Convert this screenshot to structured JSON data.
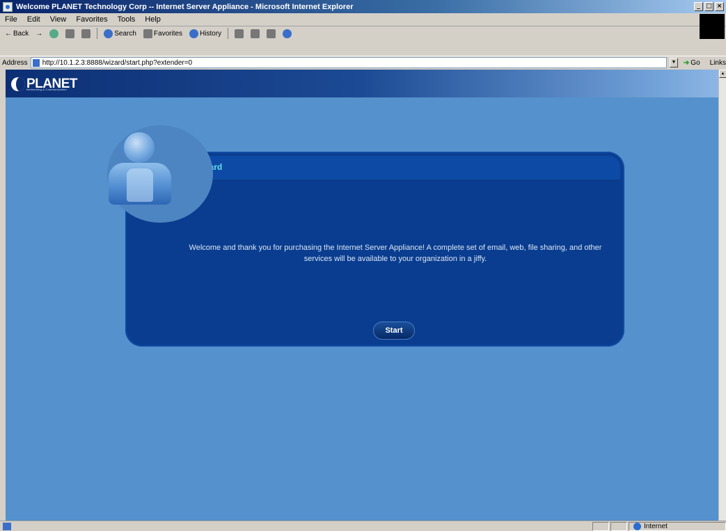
{
  "window": {
    "title": "Welcome PLANET Technology Corp -- Internet Server Appliance - Microsoft Internet Explorer",
    "controls": [
      "_",
      "□",
      "×"
    ]
  },
  "menubar": {
    "items": [
      "File",
      "Edit",
      "View",
      "Favorites",
      "Tools",
      "Help"
    ]
  },
  "toolbar": {
    "back_label": "Back",
    "search_label": "Search",
    "favorites_label": "Favorites",
    "history_label": "History"
  },
  "address": {
    "label": "Address",
    "url": "http://10.1.2.3:8888/wizard/start.php?extender=0",
    "go_label": "Go",
    "links_label": "Links"
  },
  "brand": {
    "name": "PLANET",
    "tagline": "Networking & Communication"
  },
  "wizard": {
    "title": "Wizard",
    "welcome_text": "Welcome and thank you for purchasing the Internet Server Appliance! A complete set of email, web, file sharing, and other services will be available to your organization in a jiffy.",
    "start_label": "Start"
  },
  "status": {
    "zone_label": "Internet"
  },
  "colors": {
    "page_background": "#5591cc",
    "panel": "#0a3d8f",
    "panel_header": "#0d4aa6",
    "wizard_title": "#66e0e6"
  }
}
